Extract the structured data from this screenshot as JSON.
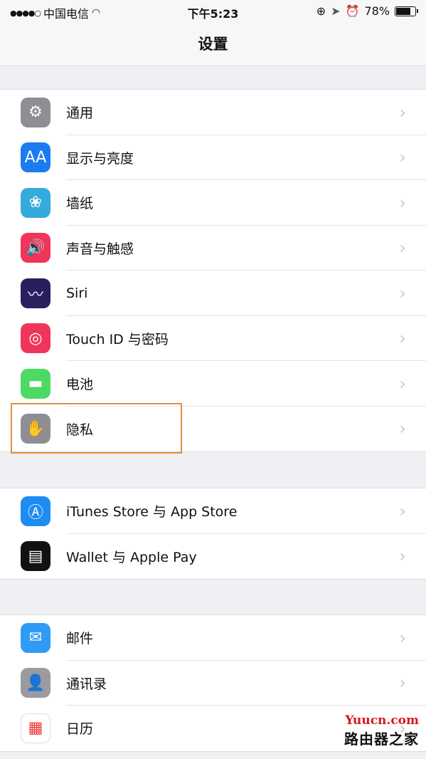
{
  "status_bar": {
    "signal": "●●●●○",
    "carrier": "中国电信",
    "wifi_icon": "wifi-icon",
    "time": "下午5:23",
    "icons": [
      "orientation-lock-icon",
      "location-icon",
      "alarm-icon"
    ],
    "battery_percent": "78%",
    "battery_level": 0.78
  },
  "nav": {
    "title": "设置"
  },
  "groups": [
    {
      "items": [
        {
          "label": "通用",
          "icon": "gear-icon",
          "color": "#8e8e93",
          "glyph": "⚙"
        },
        {
          "label": "显示与亮度",
          "icon": "display-brightness-icon",
          "color": "#1a7cf0",
          "glyph": "AA"
        },
        {
          "label": "墙纸",
          "icon": "wallpaper-flower-icon",
          "color": "#35aadc",
          "glyph": "❀"
        },
        {
          "label": "声音与触感",
          "icon": "sound-icon",
          "color": "#f0355a",
          "glyph": "🔊"
        },
        {
          "label": "Siri",
          "icon": "siri-icon",
          "color": "#2b1e5e",
          "glyph": "〰"
        },
        {
          "label": "Touch ID 与密码",
          "icon": "fingerprint-icon",
          "color": "#f0355a",
          "glyph": "◎"
        },
        {
          "label": "电池",
          "icon": "battery-icon",
          "color": "#4cd964",
          "glyph": "▬"
        },
        {
          "label": "隐私",
          "icon": "hand-icon",
          "color": "#8e8e93",
          "glyph": "✋"
        }
      ]
    },
    {
      "items": [
        {
          "label": "iTunes Store 与 App Store",
          "icon": "app-store-icon",
          "color": "#1d8cf3",
          "glyph": "Ⓐ"
        },
        {
          "label": "Wallet 与 Apple Pay",
          "icon": "wallet-icon",
          "color": "#111111",
          "glyph": "▤"
        }
      ]
    },
    {
      "items": [
        {
          "label": "邮件",
          "icon": "mail-icon",
          "color": "#2f9bf5",
          "glyph": "✉"
        },
        {
          "label": "通讯录",
          "icon": "contacts-icon",
          "color": "#9a9a9f",
          "glyph": "👤"
        },
        {
          "label": "日历",
          "icon": "calendar-icon",
          "color": "#ffffff",
          "glyph": "▦"
        }
      ]
    }
  ],
  "highlight": {
    "item": "隐私",
    "color": "#e88c3a"
  },
  "watermark": {
    "line1": "Yuucn.com",
    "line2": "路由器之家"
  }
}
